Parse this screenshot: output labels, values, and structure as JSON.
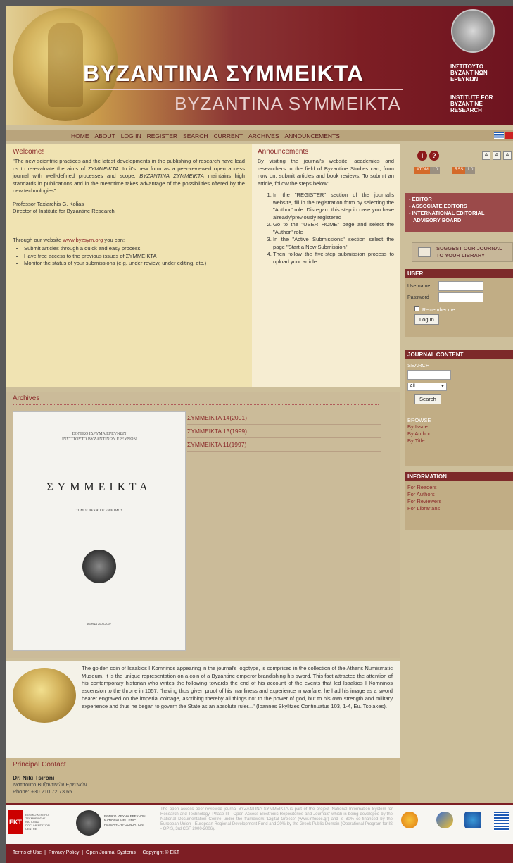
{
  "header": {
    "title": "BYZANTINA ΣΥΜΜΕΙΚΤΑ",
    "subtitle": "BYZANTINA SYMMEIKTA",
    "inst_gr": "ΙΝΣΤΙΤΟΥΤΟ\nΒΥΖΑΝΤΙΝΩΝ\nΕΡΕΥΝΩΝ",
    "inst_en": "INSTITUTE FOR\nBYZANTINE\nRESEARCH"
  },
  "nav": [
    "HOME",
    "ABOUT",
    "LOG IN",
    "REGISTER",
    "SEARCH",
    "CURRENT",
    "ARCHIVES",
    "ANNOUNCEMENTS"
  ],
  "welcome": {
    "title": "Welcome!",
    "p1_a": "\"The new scientific practices and the latest developments in the publishing of research have lead us to re-evaluate the aims of ",
    "p1_em": "ΣΥΜΜΕΙΚΤΑ",
    "p1_b": ". In it's new form as a peer-reviewed open access journal with well-defined processes and scope, ",
    "p1_em2": "BYZANTINA ΣΥΜΜΕΙΚΤΑ",
    "p1_c": " maintains high standards in publications and in the meantime takes advantage of the possibilities offered by the new technologies\".",
    "sig1": "Professor Taxiarchis G. Kolias",
    "sig2": "Director of Institute for Byzantine Research",
    "through_a": "Through our website ",
    "through_link": "www.byzsym.org",
    "through_b": " you can:",
    "bullets": [
      "Submit articles through a quick and easy process",
      "Have free access to the previous issues of ΣΥΜΜΕΙΚΤΑ",
      "Monitor the status of your submissions (e.g. under review, under editing, etc.)"
    ]
  },
  "announcements": {
    "title": "Announcements",
    "intro": "By visiting the journal's website, academics and researchers in the field of Byzantine Studies can, from now on, submit articles and book reviews. To submit an article, follow the steps below:",
    "steps": [
      "In the \"REGISTER\" section of the journal's website, fill in the registration form by selecting the \"Author\" role. Disregard this step in case you have already/previously registered",
      "Go to the \"USER HOME\" page and select the \"Author\" role",
      "In the \"Active Submissions\" section select the page \"Start a New Submission\"",
      "Then follow the five-step submission process to upload your article"
    ]
  },
  "archives": {
    "title": "Archives",
    "issues": [
      "ΣΥΜΜΕΙΚΤΑ 14(2001)",
      "ΣΥΜΜΕΙΚΤΑ 13(1999)",
      "ΣΥΜΜΕΙΚΤΑ 11(1997)"
    ],
    "cover": {
      "top1": "ΕΘΝΙΚΟ ΙΔΡΥΜΑ ΕΡΕΥΝΩΝ",
      "top2": "ΙΝΣΤΙΤΟΥΤΟ ΒΥΖΑΝΤΙΝΩΝ ΕΡΕΥΝΩΝ",
      "title": "ΣΥΜΜΕΙΚΤΑ",
      "vol": "ΤΟΜΟΣ ΔΕΚΑΤΟΣ ΕΒΔΟΜΟΣ",
      "date": "ΑΘΗΝΑ 2005-2007"
    }
  },
  "coin_text": "The golden coin of Isaakios I Komninos appearing in the journal's logotype, is comprised in the collection of the Athens Numismatic Museum. It is the unique representation on a coin of a Byzantine emperor brandishing his sword. This fact attracted the attention of his contemporary historian who writes the following towards the end of his account of the events that led Isaakios I Komninos ascension to the throne in 1057: \"having thus given proof of his manliness and experience in warfare, he had his image as a sword bearer engraved on the imperial coinage, ascribing thereby all things not to the power of god, but to his own strength and military experience and thus he began to govern the State as an absolute ruler...\" (Ioannes Skylitzes Continuatus 103, 1-4, Eu. Tsolakes).",
  "contact": {
    "title": "Principal Contact",
    "name": "Dr. Niki Tsironi",
    "org": "Ινστιτούτο Βυζαντινών Ερευνών",
    "phone": "Phone: +30 210 72 73 65"
  },
  "sidebar": {
    "feeds": [
      "ATOM",
      "1.0",
      "RSS",
      "1.0"
    ],
    "font_buttons": [
      "A",
      "A",
      "A"
    ],
    "menu": [
      "- EDITOR",
      "- ASSOCIATE EDITORS",
      "- INTERNATIONAL EDITORIAL",
      "ADVISORY BOARD"
    ],
    "suggest": "SUGGEST OUR JOURNAL TO YOUR LIBRARY",
    "user": {
      "title": "USER",
      "username_label": "Username",
      "password_label": "Password",
      "remember": "Remember me",
      "login_btn": "Log In"
    },
    "journal": {
      "title": "JOURNAL CONTENT",
      "search_label": "SEARCH",
      "select_value": "All",
      "search_btn": "Search",
      "browse_label": "BROWSE",
      "browse": [
        "By Issue",
        "By Author",
        "By Title"
      ]
    },
    "info": {
      "title": "INFORMATION",
      "links": [
        "For Readers",
        "For Authors",
        "For Reviewers",
        "For Librarians"
      ]
    }
  },
  "footer": {
    "ekt": "EKT",
    "ekt_text": "ΕΘΝΙΚΟ ΚΕΝΤΡΟ\nΤΕΚΜΗΡΙΩΣΗΣ\nNATIONAL\nDOCUMENTATION\nCENTRE",
    "nhrf_text": "ΕΘΝΙΚΟ ΙΔΡΥΜΑ ΕΡΕΥΝΩΝ\nNATIONAL HELLENIC\nRESEARCH FOUNDATION",
    "desc": "The open access peer-reviewed journal BYZANTINA SYMMEIKTA is part of the project 'National Information System for Research and Technology, Phase III - Open Access Electronic Repositories and Journals' which is being developed by the National Documentation Centre under the framework 'Digital Greece' (www.infosoc.gr) and is 80% co-financed by the European Union - European Regional Development Fund and 20% by the Greek Public Domain (Operational Program for IS - OPIS, 3rd CSF 2000-2006).",
    "links": [
      "Terms of Use",
      "Privacy Policy",
      "Open Journal Systems",
      "Copyright © EKT"
    ]
  }
}
